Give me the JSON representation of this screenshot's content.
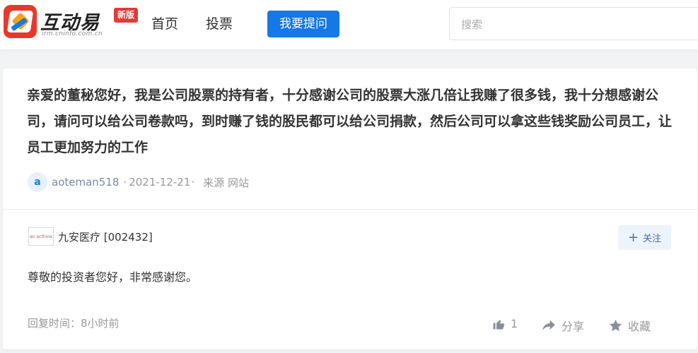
{
  "header": {
    "logo": {
      "name": "互动易",
      "badge": "新版",
      "url": "irm.cninfo.com.cn"
    },
    "nav": [
      {
        "label": "首页"
      },
      {
        "label": "投票"
      }
    ],
    "ask_button": "我要提问",
    "search": {
      "placeholder": "搜索"
    }
  },
  "question": {
    "text": "亲爱的董秘您好，我是公司股票的持有者，十分感谢公司的股票大涨几倍让我赚了很多钱，我十分想感谢公司，请问可以给公司卷款吗，到时赚了钱的股民都可以给公司捐款，然后公司可以拿这些钱奖励公司员工，让员工更加努力的工作",
    "avatar_letter": "a",
    "user": "aoteman518",
    "date": "2021-12-21",
    "source": "来源 网站"
  },
  "answer": {
    "company_logo_text": "an acthina",
    "company": "九安医疗 [002432]",
    "follow_label": "关注",
    "text": "尊敬的投资者您好，非常感谢您。",
    "reply_time": "回复时间：8小时前",
    "like_count": "1",
    "share_label": "分享",
    "favorite_label": "收藏"
  },
  "colors": {
    "accent": "#1677e6",
    "brand_red": "#e53935",
    "background": "#f2f3f5"
  }
}
